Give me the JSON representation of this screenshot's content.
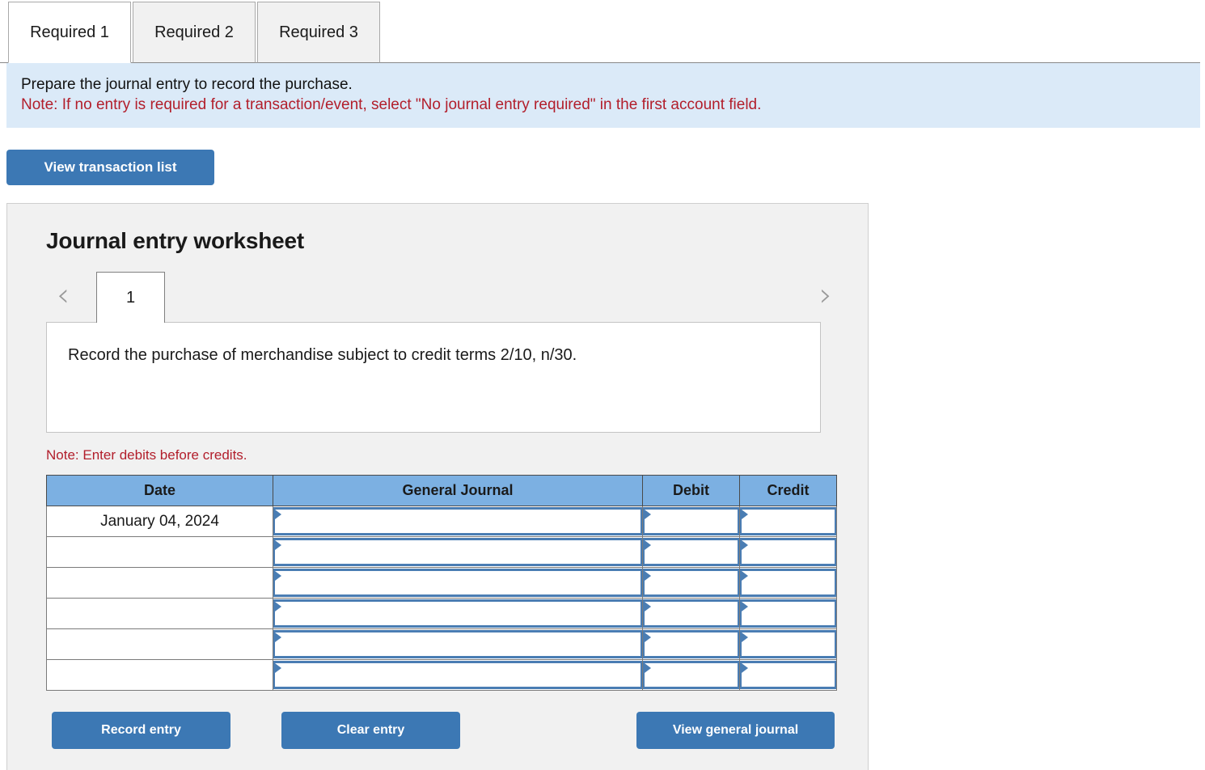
{
  "tabs": [
    {
      "label": "Required 1",
      "active": true
    },
    {
      "label": "Required 2",
      "active": false
    },
    {
      "label": "Required 3",
      "active": false
    }
  ],
  "instructions": {
    "main": "Prepare the journal entry to record the purchase.",
    "note": "Note: If no entry is required for a transaction/event, select \"No journal entry required\" in the first account field.",
    "background_color": "#dbeaf8",
    "note_color": "#b21e2b"
  },
  "toolbar": {
    "view_transaction_list_label": "View transaction list"
  },
  "worksheet": {
    "title": "Journal entry worksheet",
    "pager": {
      "prev_icon": "chevron-left-icon",
      "next_icon": "chevron-right-icon",
      "current_page": "1"
    },
    "transaction_description": "Record the purchase of merchandise subject to credit terms 2/10, n/30.",
    "debits_note": "Note: Enter debits before credits.",
    "table": {
      "headers": [
        "Date",
        "General Journal",
        "Debit",
        "Credit"
      ],
      "header_color": "#7cb0e2",
      "rows": [
        {
          "date": "January 04, 2024",
          "general_journal": "",
          "debit": "",
          "credit": ""
        },
        {
          "date": "",
          "general_journal": "",
          "debit": "",
          "credit": ""
        },
        {
          "date": "",
          "general_journal": "",
          "debit": "",
          "credit": ""
        },
        {
          "date": "",
          "general_journal": "",
          "debit": "",
          "credit": ""
        },
        {
          "date": "",
          "general_journal": "",
          "debit": "",
          "credit": ""
        },
        {
          "date": "",
          "general_journal": "",
          "debit": "",
          "credit": ""
        }
      ]
    },
    "actions": {
      "record_entry_label": "Record entry",
      "clear_entry_label": "Clear entry",
      "view_general_journal_label": "View general journal"
    },
    "accent_color": "#3c78b4"
  }
}
